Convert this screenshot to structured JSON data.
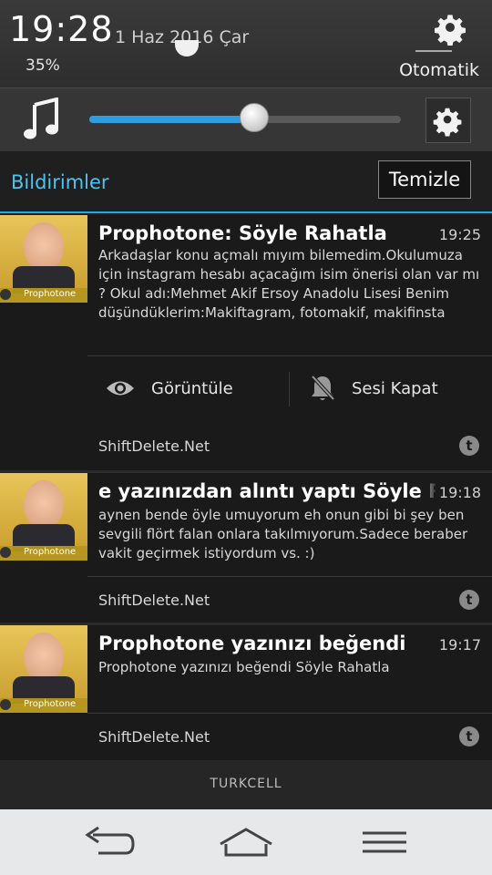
{
  "status": {
    "time": "19:28",
    "date": "1 Haz 2016 Çar",
    "brightness_value": "35%",
    "brightness_mode": "Otomatik",
    "icons": [
      "gear-icon"
    ]
  },
  "volume": {
    "icon": "music-note-icon",
    "level": 0.53,
    "accent": "#2d9de0",
    "settings_icon": "gear-icon"
  },
  "notifications": {
    "header": "Bildirimler",
    "clear_label": "Temizle",
    "accent": "#4fc3f0",
    "items": [
      {
        "title": "Prophotone: Söyle Rahatla",
        "time": "19:25",
        "body": "Arkadaşlar konu açmalı mıyım bilemedim.Okulumuza için instagram hesabı açacağım isim önerisi olan var mı ? Okul adı:Mehmet Akif Ersoy Anadolu Lisesi Benim düşündüklerim:Makiftagram, fotomakif, makifinsta",
        "actions": [
          {
            "label": "Görüntüle",
            "icon": "eye-icon"
          },
          {
            "label": "Sesi Kapat",
            "icon": "bell-off-icon"
          }
        ],
        "source": "ShiftDelete.Net",
        "app_icon": "tumblr-icon",
        "thumb_brand": "Prophotone"
      },
      {
        "title": "e yazınızdan alıntı yaptı Söyle Rahat",
        "time": "19:18",
        "body": "aynen bende öyle umuyorum eh onun gibi bi şey ben sevgili flört falan onlara takılmıyorum.Sadece beraber vakit geçirmek istiyordum vs. :)",
        "source": "ShiftDelete.Net",
        "app_icon": "tumblr-icon",
        "thumb_brand": "Prophotone"
      },
      {
        "title": "Prophotone yazınızı beğendi",
        "time": "19:17",
        "body": "Prophotone yazınızı beğendi Söyle Rahatla",
        "source": "ShiftDelete.Net",
        "app_icon": "tumblr-icon",
        "thumb_brand": "Prophotone"
      }
    ]
  },
  "carrier": "TURKCELL",
  "navbar": {
    "buttons": [
      "back-icon",
      "home-icon",
      "menu-icon"
    ]
  }
}
